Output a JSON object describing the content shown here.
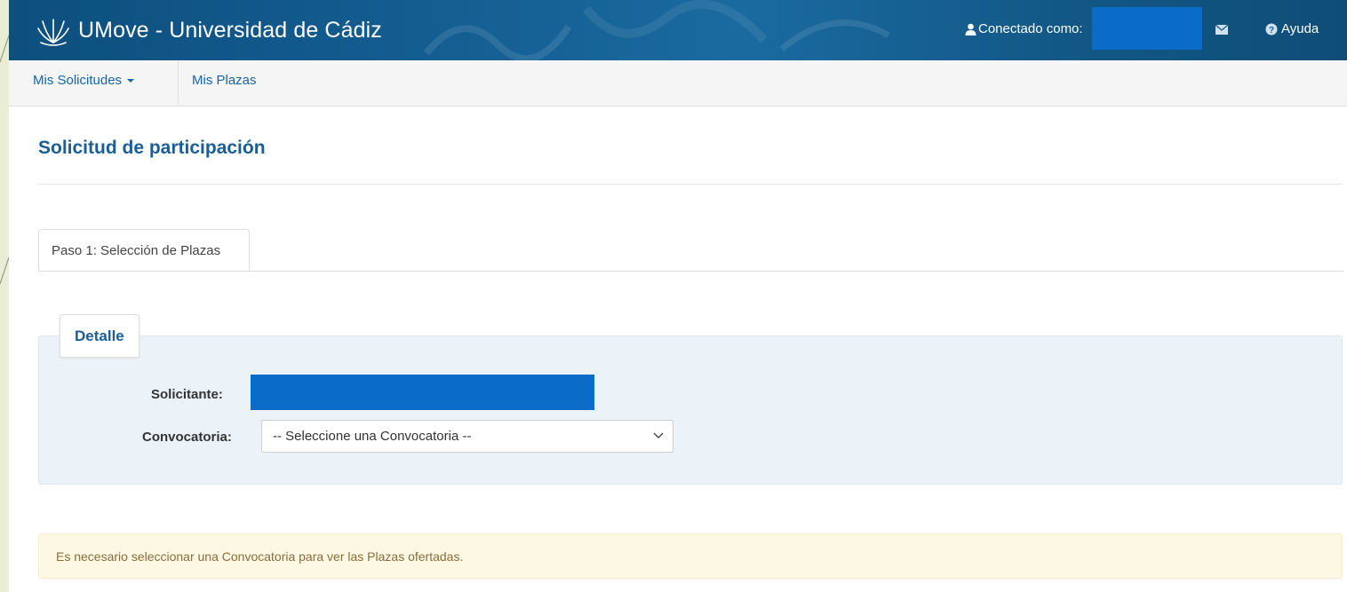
{
  "header": {
    "app_title": "UMove - Universidad de Cádiz",
    "user_label": "Conectado como:",
    "help_label": "Ayuda",
    "icons": {
      "logo": "university-logo",
      "user": "user-icon",
      "mail": "envelope-icon",
      "help": "question-circle-icon"
    }
  },
  "subnav": {
    "items": [
      {
        "label": "Mis Solicitudes",
        "has_dropdown": true
      },
      {
        "label": "Mis Plazas",
        "has_dropdown": false
      }
    ]
  },
  "main": {
    "page_title": "Solicitud de participación",
    "tabs": [
      {
        "label": "Paso 1: Selección de Plazas",
        "active": true
      }
    ],
    "panel": {
      "legend": "Detalle",
      "solicitante_label": "Solicitante:",
      "convocatoria_label": "Convocatoria:",
      "convocatoria_selected": "-- Seleccione una Convocatoria --"
    },
    "alert": "Es necesario seleccionar una Convocatoria para ver las Plazas ofertadas."
  },
  "colors": {
    "navbar": "#155f93",
    "accent_text": "#1b5e96",
    "link": "#1565a8",
    "redaction": "#0b6cc8",
    "panel_bg": "#ecf3f8",
    "alert_bg": "#fcf8e3",
    "alert_text": "#8a6d3b"
  }
}
